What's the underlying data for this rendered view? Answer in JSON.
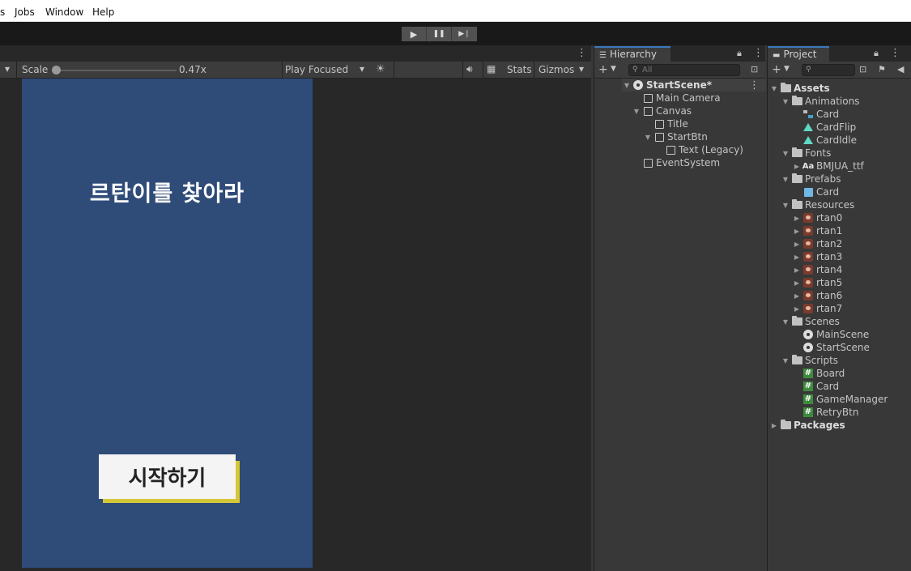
{
  "menubar": {
    "items": [
      "s",
      "Jobs",
      "Window",
      "Help"
    ]
  },
  "playmode": {
    "play": "▶",
    "pause": "❚❚",
    "step": "▶❘"
  },
  "game_toolbar": {
    "dropdown_arrow": "▾",
    "scale_label": "Scale",
    "scale_value": "0.47x",
    "play_mode_value": "Play Focused",
    "stats_label": "Stats",
    "gizmos_label": "Gizmos",
    "bug_icon": "bug-icon",
    "sound_icon": "speaker-icon",
    "grid_icon": "grid-icon"
  },
  "game_view": {
    "background": "#2f4b78",
    "title": "르탄이를 찾아라",
    "start_button": "시작하기",
    "button_shadow": "#d6c738"
  },
  "hierarchy": {
    "tab_label": "Hierarchy",
    "search_placeholder": "All",
    "scene_name": "StartScene*",
    "items": [
      {
        "label": "Main Camera"
      },
      {
        "label": "Canvas"
      },
      {
        "label": "Title"
      },
      {
        "label": "StartBtn"
      },
      {
        "label": "Text (Legacy)"
      },
      {
        "label": "EventSystem"
      }
    ]
  },
  "project": {
    "tab_label": "Project",
    "assets_label": "Assets",
    "packages_label": "Packages",
    "folders": {
      "animations": {
        "label": "Animations",
        "items": [
          "Card",
          "CardFlip",
          "CardIdle"
        ]
      },
      "fonts": {
        "label": "Fonts",
        "items": [
          "BMJUA_ttf"
        ],
        "font_icon": "Aa"
      },
      "prefabs": {
        "label": "Prefabs",
        "items": [
          "Card"
        ]
      },
      "resources": {
        "label": "Resources",
        "items": [
          "rtan0",
          "rtan1",
          "rtan2",
          "rtan3",
          "rtan4",
          "rtan5",
          "rtan6",
          "rtan7"
        ]
      },
      "scenes": {
        "label": "Scenes",
        "items": [
          "MainScene",
          "StartScene"
        ]
      },
      "scripts": {
        "label": "Scripts",
        "items": [
          "Board",
          "Card",
          "GameManager",
          "RetryBtn"
        ]
      }
    }
  }
}
